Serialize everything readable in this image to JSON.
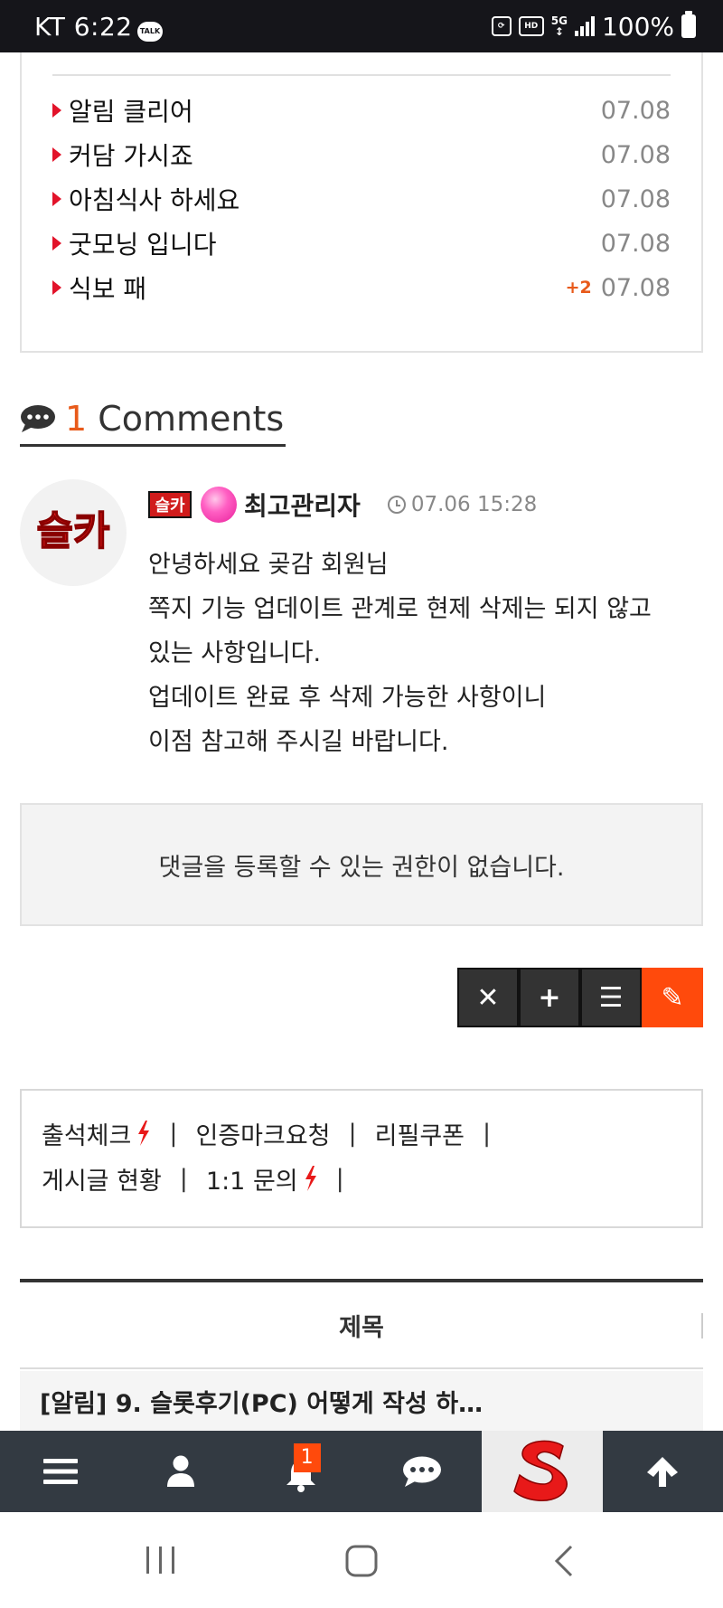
{
  "status_bar": {
    "carrier_time": "KT 6:22",
    "talk_label": "TALK",
    "hd_label": "HD",
    "network": "5G",
    "battery": "100%"
  },
  "recent_posts": [
    {
      "title": "알림 클리어",
      "date": "07.08",
      "extra": ""
    },
    {
      "title": "커담 가시죠",
      "date": "07.08",
      "extra": ""
    },
    {
      "title": "아침식사 하세요",
      "date": "07.08",
      "extra": ""
    },
    {
      "title": "굿모닝 입니다",
      "date": "07.08",
      "extra": ""
    },
    {
      "title": "식보 패",
      "date": "07.08",
      "extra": "+2"
    }
  ],
  "comments": {
    "count": "1",
    "label": "Comments",
    "items": [
      {
        "level_badge": "슬카",
        "author": "최고관리자",
        "time": "07.06 15:28",
        "avatar_text": "슬카",
        "lines": [
          "안녕하세요 곶감 회원님",
          "쪽지 기능 업데이트 관계로 현제 삭제는 되지 않고",
          "있는 사항입니다.",
          "업데이트 완료 후 삭제 가능한 사항이니",
          "이점 참고해 주시길 바랍니다."
        ]
      }
    ]
  },
  "no_permission": "댓글을 등록할 수 있는 권한이 없습니다.",
  "actions": {
    "close": "✕",
    "add": "+",
    "list": "☰",
    "write": "✎"
  },
  "links": {
    "line1": [
      "출석체크",
      "인증마크요청",
      "리필쿠폰"
    ],
    "line2": [
      "게시글 현황",
      "1:1 문의"
    ]
  },
  "table": {
    "header": "제목",
    "first_row": "[알림] 9. 슬롯후기(PC) 어떻게 작성 하…"
  },
  "bottom_nav": {
    "notification_count": "1"
  },
  "colors": {
    "accent_orange": "#ff4a0c",
    "triangle_red": "#e2132a",
    "nav_bg": "#333a42"
  }
}
